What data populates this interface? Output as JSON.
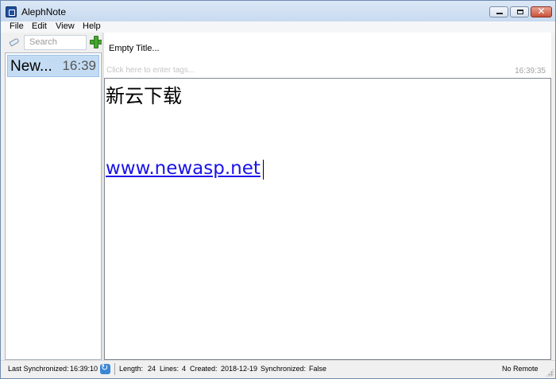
{
  "window": {
    "title": "AlephNote",
    "close_glyph": "✕"
  },
  "menu": {
    "items": [
      "File",
      "Edit",
      "View",
      "Help"
    ]
  },
  "sidebar": {
    "search_placeholder": "Search",
    "notes": [
      {
        "title": "New...",
        "time": "16:39"
      }
    ]
  },
  "editor": {
    "title": "Empty Title...",
    "tags_placeholder": "Click here to enter tags...",
    "modified_time": "16:39:35",
    "content_line1": "新云下载",
    "content_line2": "www.newasp.net"
  },
  "status": {
    "last_sync_label": "Last Synchronized:",
    "last_sync_value": "16:39:10",
    "length_label": "Length:",
    "length_value": "24",
    "lines_label": "Lines:",
    "lines_value": "4",
    "created_label": "Created:",
    "created_value": "2018-12-19",
    "synchronized_label": "Synchronized:",
    "synchronized_value": "False",
    "remote": "No Remote"
  },
  "icons": [
    "app-icon",
    "minimize-icon",
    "maximize-icon",
    "close-icon",
    "tag-icon",
    "add-icon",
    "sync-icon",
    "resize-grip-icon"
  ],
  "colors": {
    "selection": "#c4dcf3",
    "link": "#1a13e8",
    "add_green": "#45a62f"
  }
}
